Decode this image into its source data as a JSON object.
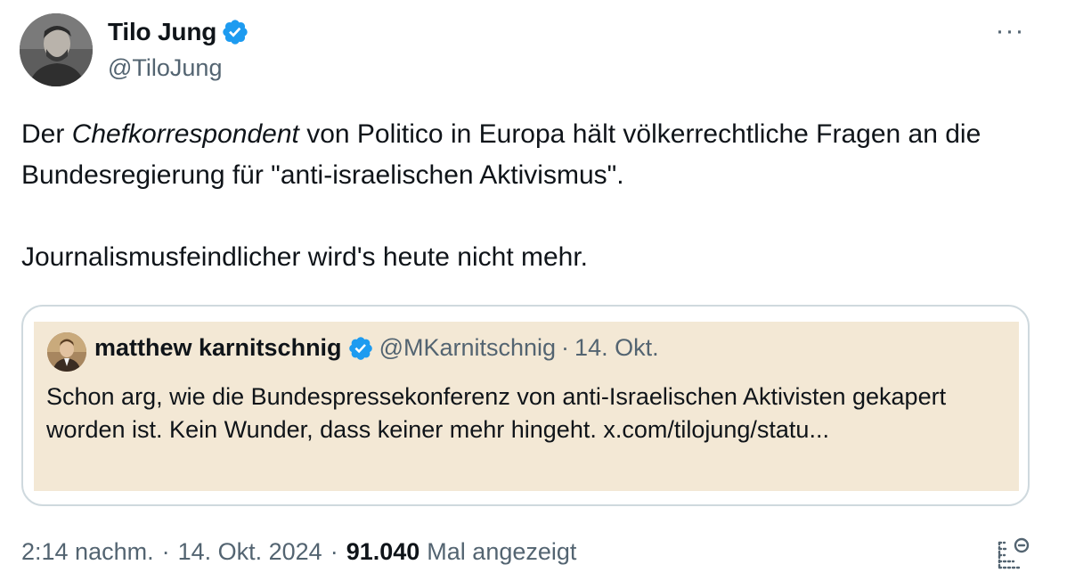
{
  "author": {
    "display_name": "Tilo Jung",
    "handle": "@TiloJung",
    "avatar_icon": "person-photo",
    "verified": true
  },
  "menu": {
    "more_label": "···"
  },
  "tweet": {
    "text_part1_before": "Der ",
    "text_part1_italic": "Chefkorrespondent",
    "text_part1_after": " von Politico in Europa hält völkerrechtliche Fragen an die Bundesregierung für \"anti-israelischen Aktivismus\".",
    "text_part2": "Journalismusfeindlicher wird's heute nicht mehr."
  },
  "quote": {
    "display_name": "matthew karnitschnig",
    "handle": "@MKarnitschnig",
    "separator": "·",
    "date": "14. Okt.",
    "text": "Schon arg, wie die Bundespressekonferenz von anti-Israelischen Aktivisten gekapert worden ist. Kein Wunder, dass keiner mehr hingeht. x.com/tilojung/statu...",
    "background_color": "#f3e8d5"
  },
  "meta": {
    "time": "2:14 nachm.",
    "separator": "·",
    "date": "14. Okt. 2024",
    "views_count": "91.040",
    "views_label": "Mal angezeigt"
  },
  "colors": {
    "text_primary": "#0f1419",
    "text_secondary": "#536471",
    "verified_blue": "#1d9bf0",
    "border": "#cfd9de"
  }
}
